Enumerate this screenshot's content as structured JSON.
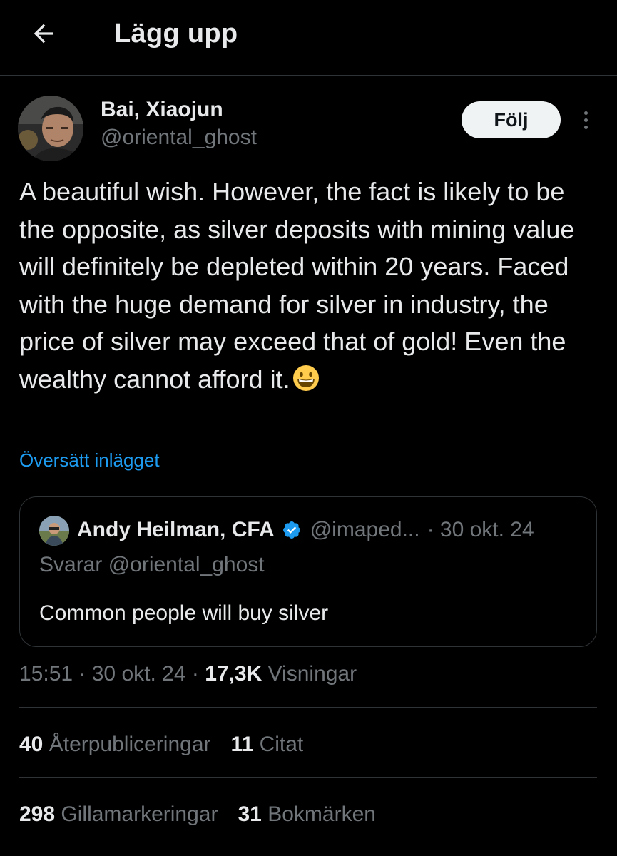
{
  "header": {
    "title": "Lägg upp",
    "back_icon": "arrow-left-icon"
  },
  "tweet": {
    "author_name": "Bai, Xiaojun",
    "author_handle": "@oriental_ghost",
    "follow_label": "Följ",
    "more_icon": "more-vertical-icon",
    "text": "A beautiful wish. However, the fact is likely to be the opposite, as silver deposits with mining value will definitely be depleted within 20 years. Faced with the huge demand for silver in industry, the price of silver may exceed that of gold! Even the wealthy cannot afford it.",
    "emoji": "grinning-face-emoji",
    "translate_label": "Översätt inlägget"
  },
  "quote": {
    "author_name": "Andy Heilman, CFA",
    "verified_icon": "verified-badge-icon",
    "handle": "@imaped...",
    "date": "· 30 okt. 24",
    "reply_to": "Svarar @oriental_ghost",
    "text": "Common people will buy silver"
  },
  "meta": {
    "time": "15:51",
    "sep1": " · ",
    "date": "30 okt. 24",
    "sep2": " · ",
    "views_count": "17,3K",
    "views_label": " Visningar"
  },
  "stats": {
    "reposts_count": "40",
    "reposts_label": "Återpubliceringar",
    "quotes_count": "11",
    "quotes_label": "Citat",
    "likes_count": "298",
    "likes_label": "Gillamarkeringar",
    "bookmarks_count": "31",
    "bookmarks_label": "Bokmärken"
  },
  "colors": {
    "background": "#000000",
    "text_primary": "#e7e9ea",
    "text_secondary": "#71767b",
    "accent_link": "#1d9bf0",
    "border": "#2f3336",
    "follow_button_bg": "#eff3f4"
  }
}
